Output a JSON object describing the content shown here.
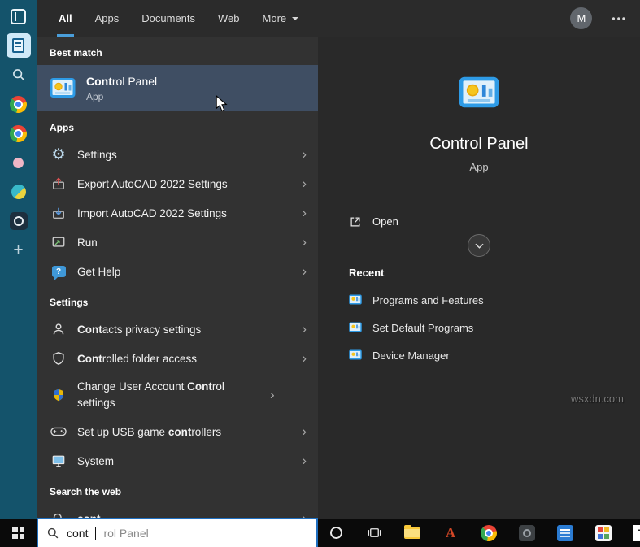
{
  "colors": {
    "accent_blue": "#4a9eda",
    "best_match_highlight": "#3f4e63",
    "sidebar_strip": "#14536b",
    "taskbar": "#0a0a0a",
    "left_pane": "#323232",
    "right_pane": "#292929",
    "search_box_border": "#1f6fc0"
  },
  "sidebar": {
    "icons": [
      "collections-icon",
      "notes-icon",
      "search-icon",
      "chrome-icon",
      "chrome-icon",
      "pink-app-icon",
      "sphere-app-icon",
      "dark-app-icon",
      "add-tab-icon"
    ]
  },
  "search_header": {
    "tabs": [
      {
        "label": "All"
      },
      {
        "label": "Apps"
      },
      {
        "label": "Documents"
      },
      {
        "label": "Web"
      },
      {
        "label": "More"
      }
    ],
    "active_tab": "All",
    "avatar_initial": "M",
    "more_options_icon": "ellipsis-icon"
  },
  "results": {
    "best_match": {
      "section": "Best match",
      "icon": "control-panel-icon",
      "title_match": "Cont",
      "title_rest": "rol Panel",
      "subtitle": "App"
    },
    "apps": {
      "section": "Apps",
      "items": [
        {
          "icon": "settings-gear-icon",
          "pre": "Settings",
          "match": "",
          "post": ""
        },
        {
          "icon": "export-settings-icon",
          "pre": "Export AutoCAD 2022 Settings",
          "match": "",
          "post": ""
        },
        {
          "icon": "import-settings-icon",
          "pre": "Import AutoCAD 2022 Settings",
          "match": "",
          "post": ""
        },
        {
          "icon": "run-icon",
          "pre": "Run",
          "match": "",
          "post": ""
        },
        {
          "icon": "get-help-icon",
          "pre": "Get Help",
          "match": "",
          "post": ""
        }
      ]
    },
    "settings": {
      "section": "Settings",
      "items": [
        {
          "icon": "contacts-icon",
          "pre": "",
          "match": "Cont",
          "post": "acts privacy settings"
        },
        {
          "icon": "shield-icon",
          "pre": "",
          "match": "Cont",
          "post": "rolled folder access"
        },
        {
          "icon": "uac-shield-icon",
          "pre": "Change User Account ",
          "match": "Cont",
          "post": "rol settings"
        },
        {
          "icon": "gamepad-icon",
          "pre": "Set up USB game ",
          "match": "cont",
          "post": "rollers"
        },
        {
          "icon": "system-monitor-icon",
          "pre": "System",
          "match": "",
          "post": ""
        }
      ]
    },
    "web": {
      "section": "Search the web",
      "items": [
        {
          "icon": "search-icon",
          "pre": "",
          "match": "cont",
          "post": ""
        }
      ]
    }
  },
  "preview": {
    "icon": "control-panel-icon",
    "app_name": "Control Panel",
    "app_type": "App",
    "open_label": "Open",
    "recent_section": "Recent",
    "recent_items": [
      {
        "icon": "control-panel-mini-icon",
        "label": "Programs and Features"
      },
      {
        "icon": "control-panel-mini-icon",
        "label": "Set Default Programs"
      },
      {
        "icon": "control-panel-mini-icon",
        "label": "Device Manager"
      }
    ]
  },
  "taskbar": {
    "search": {
      "typed": "cont",
      "completion": "rol Panel"
    },
    "autocad_glyph": "A",
    "t_glyph": "T",
    "icons": [
      "start-button",
      "cortana-icon",
      "task-view-icon",
      "file-explorer-icon",
      "autocad-icon",
      "chrome-icon",
      "gray-app-icon",
      "blue-document-app-icon",
      "colorful-app-icon",
      "t-app-icon"
    ]
  },
  "watermark": "wsxdn.com"
}
